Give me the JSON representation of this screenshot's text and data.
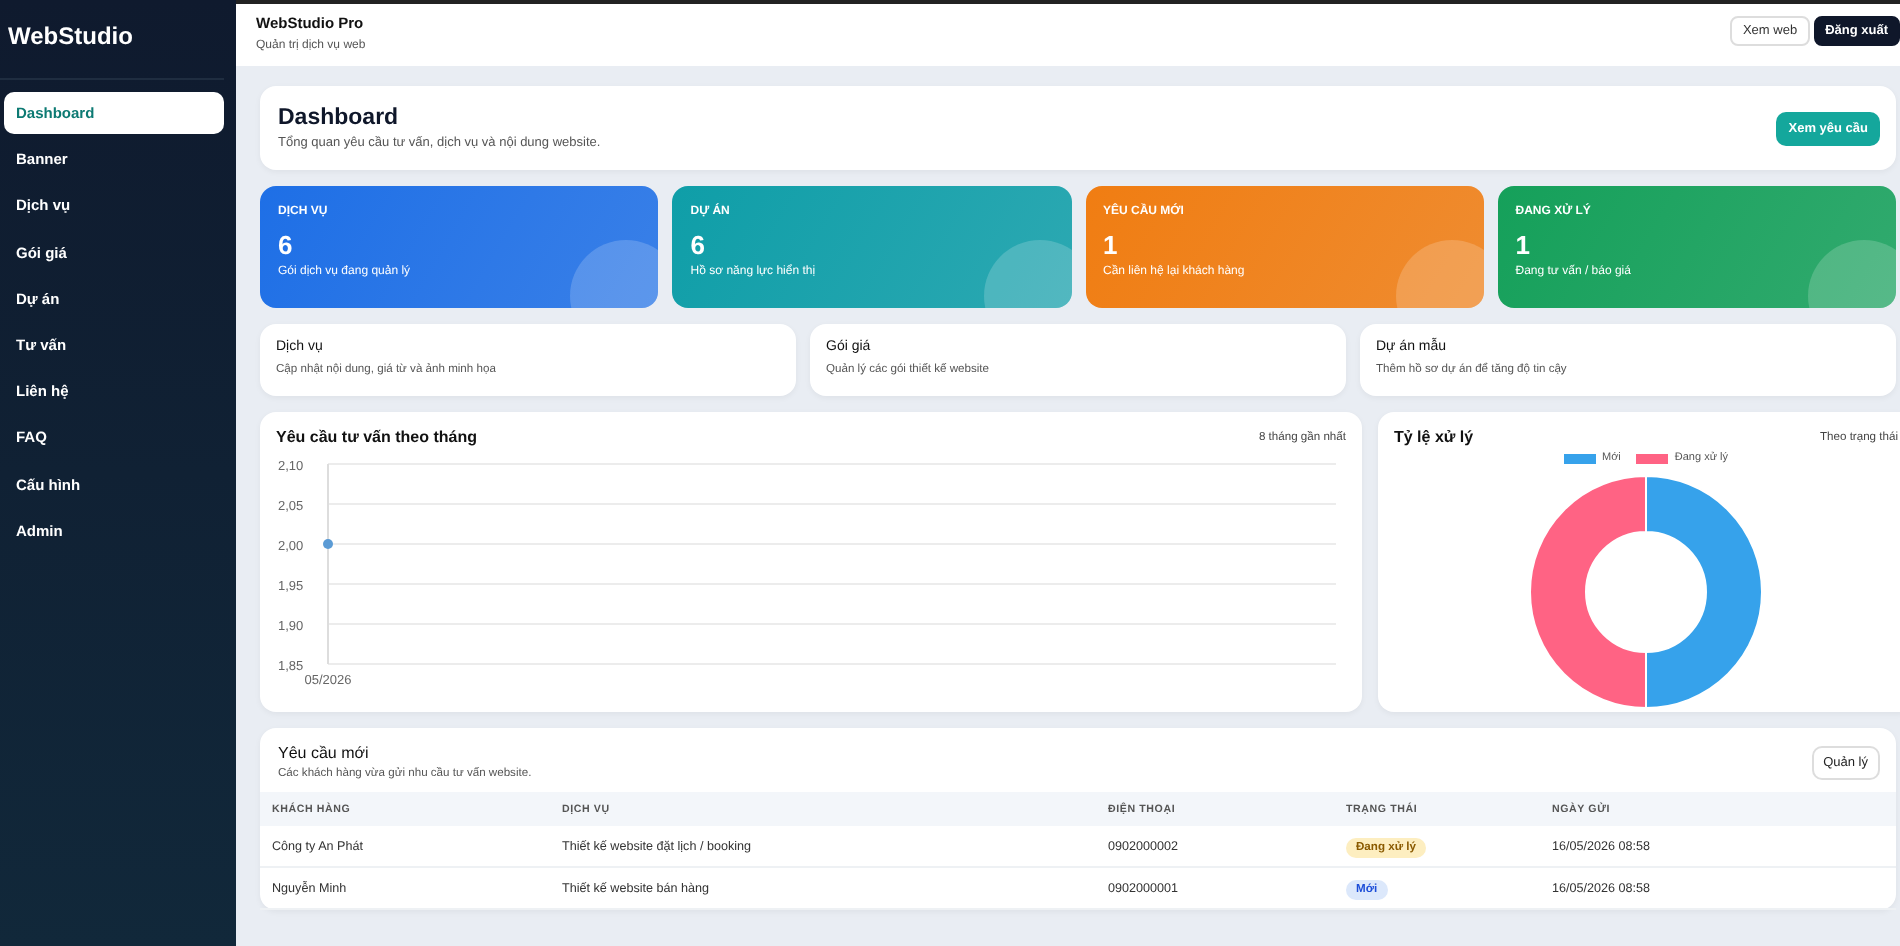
{
  "sidebar": {
    "brand": "WebStudio",
    "items": [
      {
        "label": "Dashboard",
        "selected": true
      },
      {
        "label": "Banner",
        "selected": false
      },
      {
        "label": "Dịch vụ",
        "selected": false
      },
      {
        "label": "Gói giá",
        "selected": false
      },
      {
        "label": "Dự án",
        "selected": false
      },
      {
        "label": "Tư vấn",
        "selected": false
      },
      {
        "label": "Liên hệ",
        "selected": false
      },
      {
        "label": "FAQ",
        "selected": false
      },
      {
        "label": "Cấu hình",
        "selected": false
      },
      {
        "label": "Admin",
        "selected": false
      }
    ]
  },
  "topbar": {
    "title": "WebStudio Pro",
    "subtitle": "Quản trị dịch vụ web",
    "buttons": [
      {
        "label": "Xem web",
        "kind": "outline"
      },
      {
        "label": "Đăng xuất",
        "kind": "dark"
      }
    ]
  },
  "header": {
    "title": "Dashboard",
    "subtitle": "Tổng quan yêu cầu tư vấn, dịch vụ và nội dung website.",
    "button": "Xem yêu cầu"
  },
  "stats": [
    {
      "label": "DỊCH VỤ",
      "value": "6",
      "note": "Gói dịch vụ đang quản lý",
      "color": "#1e6fe6"
    },
    {
      "label": "DỰ ÁN",
      "value": "6",
      "note": "Hồ sơ năng lực hiển thị",
      "color": "#0f9ea8"
    },
    {
      "label": "YÊU CẦU MỚI",
      "value": "1",
      "note": "Cần liên hệ lại khách hàng",
      "color": "#f07d12"
    },
    {
      "label": "ĐANG XỬ LÝ",
      "value": "1",
      "note": "Đang tư vấn / báo giá",
      "color": "#15a05a"
    }
  ],
  "shortcuts": [
    {
      "title": "Dịch vụ",
      "text": "Cập nhật nội dung, giá từ và ảnh minh họa"
    },
    {
      "title": "Gói giá",
      "text": "Quản lý các gói thiết kế website"
    },
    {
      "title": "Dự án mẫu",
      "text": "Thêm hồ sơ dự án để tăng độ tin cậy"
    }
  ],
  "line_panel": {
    "title": "Yêu cầu tư vấn theo tháng",
    "note": "8 tháng gần nhất",
    "chart_data": {
      "type": "line",
      "x": [
        "05/2026"
      ],
      "series": [
        {
          "color": "#5b9bd5",
          "marker": "circle",
          "values": [
            2
          ]
        }
      ],
      "grid": true,
      "ylim": [
        1.85,
        2.1
      ],
      "yticks": [
        {
          "value": 1.85,
          "label": "1,85"
        },
        {
          "value": 1.9,
          "label": "1,90"
        },
        {
          "value": 1.95,
          "label": "1,95"
        },
        {
          "value": 2,
          "label": "2,00"
        },
        {
          "value": 2.05,
          "label": "2,05"
        },
        {
          "value": 2.1,
          "label": "2,10"
        }
      ]
    }
  },
  "donut_panel": {
    "title": "Tỷ lệ xử lý",
    "note": "Theo trạng thái",
    "chart_data": {
      "type": "donut",
      "categories": [
        "Mới",
        "Đang xử lý"
      ],
      "values": [
        50,
        50
      ],
      "colors": [
        "#36a2eb",
        "#ff6384"
      ]
    }
  },
  "requests": {
    "title": "Yêu cầu mới",
    "subtitle": "Các khách hàng vừa gửi nhu cầu tư vấn website.",
    "button": "Quản lý",
    "columns": [
      "KHÁCH HÀNG",
      "DỊCH VỤ",
      "ĐIỆN THOẠI",
      "TRẠNG THÁI",
      "NGÀY GỬI"
    ],
    "rows": [
      {
        "customer": "Công ty An Phát",
        "service": "Thiết kế website đặt lịch / booking",
        "phone": "0902000002",
        "status": "Đang xử lý",
        "kind": "processing",
        "date": "16/05/2026 08:58"
      },
      {
        "customer": "Nguyễn Minh",
        "service": "Thiết kế website bán hàng",
        "phone": "0902000001",
        "status": "Mới",
        "kind": "new",
        "date": "16/05/2026 08:58"
      }
    ]
  }
}
